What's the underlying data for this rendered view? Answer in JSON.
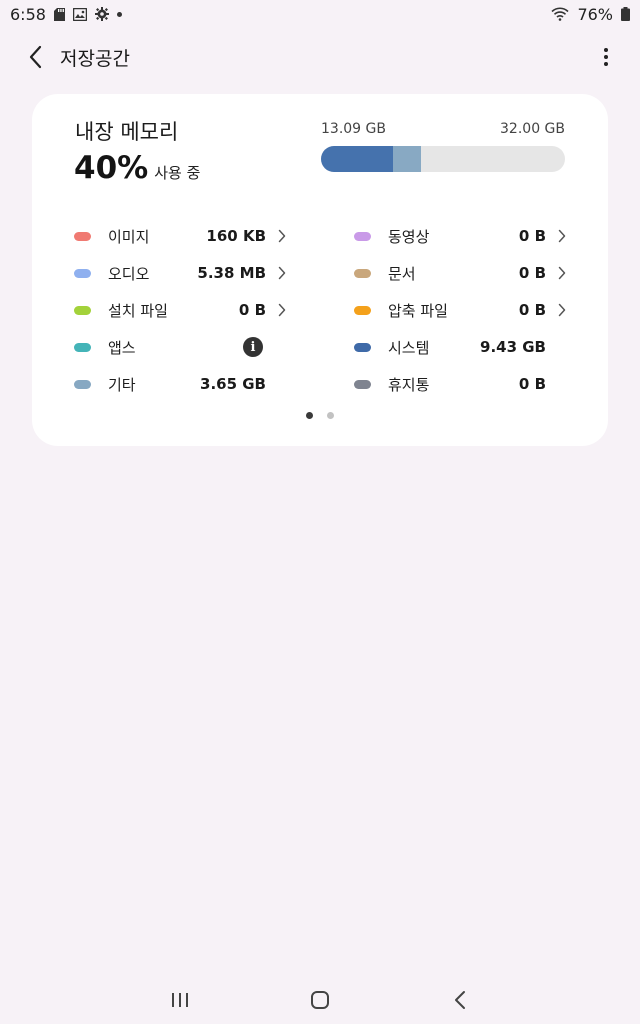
{
  "status_bar": {
    "time": "6:58",
    "battery": "76%"
  },
  "app_bar": {
    "title": "저장공간"
  },
  "storage": {
    "heading": "내장 메모리",
    "used_percent": "40%",
    "used_suffix": "사용 중",
    "used_amount": "13.09 GB",
    "total_amount": "32.00 GB",
    "bar": {
      "system_fraction": 0.295,
      "other_fraction": 0.114
    }
  },
  "categories": [
    {
      "label": "이미지",
      "value": "160 KB",
      "color": "#f07a72",
      "chevron": true
    },
    {
      "label": "동영상",
      "value": "0 B",
      "color": "#c99ae8",
      "chevron": true
    },
    {
      "label": "오디오",
      "value": "5.38 MB",
      "color": "#8fb0ef",
      "chevron": true
    },
    {
      "label": "문서",
      "value": "0 B",
      "color": "#c9a77c",
      "chevron": true
    },
    {
      "label": "설치 파일",
      "value": "0 B",
      "color": "#a3d23a",
      "chevron": true
    },
    {
      "label": "압축 파일",
      "value": "0 B",
      "color": "#f4a11b",
      "chevron": true
    },
    {
      "label": "앱스",
      "value": "",
      "color": "#44b4b8",
      "chevron": false,
      "info": "i"
    },
    {
      "label": "시스템",
      "value": "9.43 GB",
      "color": "#3f6aa8",
      "chevron": false
    },
    {
      "label": "기타",
      "value": "3.65 GB",
      "color": "#87a8c2",
      "chevron": false
    },
    {
      "label": "휴지통",
      "value": "0 B",
      "color": "#7f8490",
      "chevron": false
    }
  ],
  "pager": {
    "active_page": 1,
    "page_count": 2
  }
}
